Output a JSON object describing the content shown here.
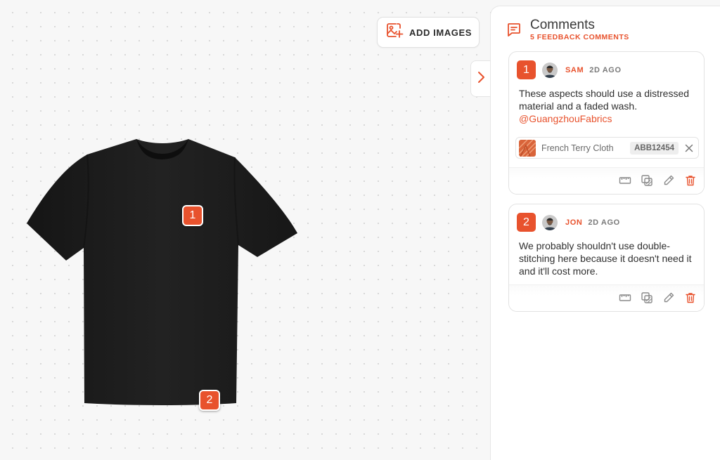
{
  "toolbar": {
    "add_images_label": "ADD IMAGES"
  },
  "canvas": {
    "pins": [
      {
        "number": "1"
      },
      {
        "number": "2"
      }
    ]
  },
  "comments_panel": {
    "title": "Comments",
    "subtitle": "5 FEEDBACK COMMENTS",
    "comments": [
      {
        "number": "1",
        "author": "SAM",
        "time": "2D AGO",
        "text": "These aspects should use a distressed material and a faded wash.",
        "mention": "@GuangzhouFabrics",
        "material": {
          "name": "French Terry Cloth",
          "code": "ABB12454"
        }
      },
      {
        "number": "2",
        "author": "JON",
        "time": "2D AGO",
        "text": "We probably shouldn't use double-stitching here because it doesn't need it and it'll cost more."
      }
    ]
  },
  "icons": {
    "add_images": "image-plus-icon",
    "toggle": "chevron-right-icon",
    "comments": "message-square-icon",
    "actions": [
      "ruler-icon",
      "layers-icon",
      "pencil-icon",
      "trash-icon"
    ]
  },
  "colors": {
    "accent": "#e8522d",
    "garment": "#1e1e1e"
  }
}
